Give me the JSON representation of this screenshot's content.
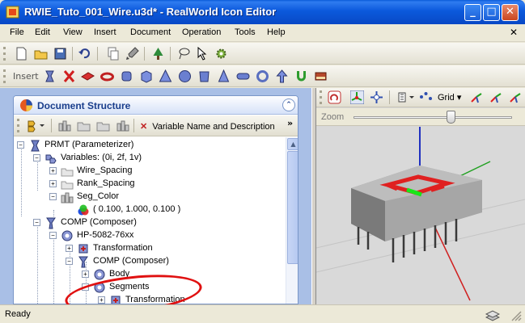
{
  "window": {
    "title": "RWIE_Tuto_001_Wire.u3d* - RealWorld Icon Editor",
    "min_symbol": "_",
    "max_symbol": "□",
    "close_symbol": "✕"
  },
  "menu": {
    "items": [
      "File",
      "Edit",
      "View",
      "Insert",
      "Document",
      "Operation",
      "Tools",
      "Help"
    ],
    "mdi_close": "✕"
  },
  "toolbar2": {
    "label": "Insert"
  },
  "doc_panel": {
    "title": "Document Structure",
    "collapse_symbol": "⌃",
    "variable_button": "Variable Name and Description",
    "more_symbol": "»"
  },
  "tree": [
    {
      "label": "PRMT (Parameterizer)",
      "icon": "parameterizer-icon",
      "exp": "−"
    },
    {
      "label": "Variables: (0i, 2f, 1v)",
      "icon": "variables-icon",
      "exp": "−"
    },
    {
      "label": "Wire_Spacing",
      "icon": "folder-icon",
      "exp": "+"
    },
    {
      "label": "Rank_Spacing",
      "icon": "folder-icon",
      "exp": "+"
    },
    {
      "label": "Seg_Color",
      "icon": "vector-icon",
      "exp": "−"
    },
    {
      "label": "( 0.100, 1.000, 0.100 )",
      "icon": "color-value-icon",
      "exp": ""
    },
    {
      "label": "COMP (Composer)",
      "icon": "composer-icon",
      "exp": "−"
    },
    {
      "label": "HP-5082-76xx",
      "icon": "part-icon",
      "exp": "−"
    },
    {
      "label": "Transformation",
      "icon": "transformation-icon",
      "exp": "+"
    },
    {
      "label": "COMP (Composer)",
      "icon": "composer-icon",
      "exp": "−"
    },
    {
      "label": "Body",
      "icon": "part-icon",
      "exp": "+"
    },
    {
      "label": "Segments",
      "icon": "part-icon",
      "exp": "−"
    },
    {
      "label": "Transformation",
      "icon": "transformation-icon",
      "exp": "+"
    }
  ],
  "view_panel": {
    "grid_label": "Grid",
    "zoom_label": "Zoom",
    "zoom_level": 0.62
  },
  "status": {
    "text": "Ready"
  },
  "colors": {
    "titlebar": "#0b59dc",
    "annotation": "#e01010",
    "segment_green": "#19e619",
    "segment_red": "#e02020"
  }
}
